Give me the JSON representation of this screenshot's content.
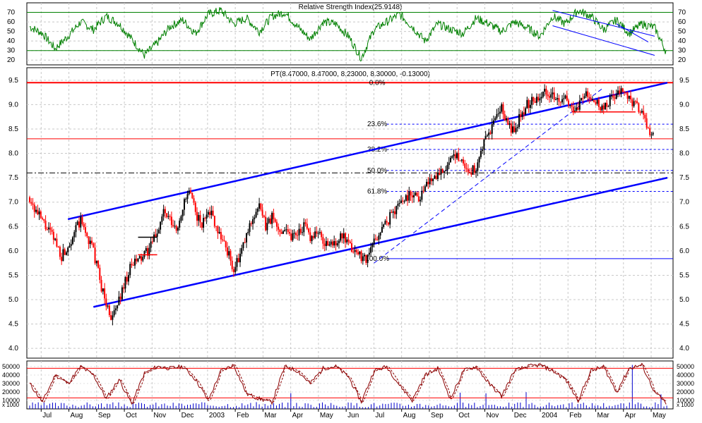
{
  "chart_data": [
    {
      "type": "line",
      "panel": "rsi",
      "title": "Relative Strength Index(25.9148)",
      "ylim": [
        15,
        80
      ],
      "yticks": [
        20,
        30,
        40,
        50,
        60,
        70
      ],
      "reference_lines": [
        30,
        70
      ],
      "grid": true,
      "colors": {
        "line": "#008000",
        "reference": "#008000",
        "trend": "#0000ff"
      },
      "series": [
        {
          "x": [
            0,
            2,
            4,
            6,
            8,
            10,
            12,
            14,
            16,
            18,
            20,
            22,
            24,
            26,
            28,
            30,
            32,
            34,
            36,
            38,
            40,
            42,
            44,
            46,
            48,
            50,
            52,
            54,
            56,
            58,
            60,
            62,
            64,
            66,
            68,
            70,
            72,
            74,
            76,
            78,
            80,
            82,
            84,
            86,
            88,
            90,
            92,
            94,
            96,
            98,
            100
          ],
          "values": [
            55,
            48,
            32,
            45,
            60,
            52,
            66,
            58,
            42,
            25,
            38,
            55,
            62,
            48,
            68,
            72,
            58,
            64,
            50,
            66,
            70,
            55,
            42,
            60,
            58,
            45,
            22,
            52,
            60,
            68,
            55,
            40,
            58,
            52,
            48,
            64,
            58,
            50,
            60,
            54,
            45,
            66,
            58,
            72,
            66,
            52,
            62,
            48,
            58,
            54,
            26
          ]
        }
      ],
      "trend_lines": [
        {
          "points": [
            [
              82,
              72
            ],
            [
              98,
              45
            ]
          ]
        },
        {
          "points": [
            [
              82,
              56
            ],
            [
              98,
              25
            ]
          ]
        },
        {
          "points": [
            [
              92,
              58
            ],
            [
              97,
              39
            ]
          ]
        }
      ]
    },
    {
      "type": "candlestick",
      "panel": "price",
      "title": "PT(8.47000, 8.47000, 8.23000, 8.30000, -0.13000)",
      "ylim": [
        3.8,
        9.7
      ],
      "yticks": [
        4.0,
        4.5,
        5.0,
        5.5,
        6.0,
        6.5,
        7.0,
        7.5,
        8.0,
        8.5,
        9.0,
        9.5
      ],
      "x_tick_labels": [
        "Jul",
        "Aug",
        "Sep",
        "Oct",
        "Nov",
        "Dec",
        "2003",
        "Feb",
        "Mar",
        "Apr",
        "May",
        "Jun",
        "Jul",
        "Aug",
        "Sep",
        "Oct",
        "Nov",
        "Dec",
        "2004",
        "Feb",
        "Mar",
        "Apr",
        "May"
      ],
      "grid": true,
      "colors": {
        "up": "#000000",
        "down": "#ff0000",
        "channel": "#0000ff",
        "level": "#ff0000",
        "fib": "#0000ff"
      },
      "close_path": [
        [
          0,
          7.1
        ],
        [
          1,
          6.8
        ],
        [
          2,
          6.6
        ],
        [
          3,
          6.4
        ],
        [
          4,
          6.2
        ],
        [
          5,
          5.9
        ],
        [
          6,
          6.1
        ],
        [
          7,
          6.4
        ],
        [
          8,
          6.6
        ],
        [
          9,
          6.3
        ],
        [
          10,
          6.0
        ],
        [
          11,
          5.4
        ],
        [
          12,
          4.9
        ],
        [
          13,
          4.6
        ],
        [
          14,
          5.0
        ],
        [
          15,
          5.4
        ],
        [
          16,
          5.7
        ],
        [
          17,
          5.8
        ],
        [
          18,
          5.9
        ],
        [
          19,
          6.1
        ],
        [
          20,
          6.4
        ],
        [
          21,
          6.8
        ],
        [
          22,
          6.6
        ],
        [
          23,
          6.4
        ],
        [
          24,
          6.9
        ],
        [
          25,
          7.2
        ],
        [
          26,
          6.8
        ],
        [
          27,
          6.5
        ],
        [
          28,
          6.9
        ],
        [
          29,
          6.6
        ],
        [
          30,
          6.3
        ],
        [
          31,
          6.0
        ],
        [
          32,
          5.6
        ],
        [
          33,
          5.9
        ],
        [
          34,
          6.3
        ],
        [
          35,
          6.7
        ],
        [
          36,
          6.9
        ],
        [
          37,
          6.5
        ],
        [
          38,
          6.7
        ],
        [
          39,
          6.4
        ],
        [
          40,
          6.5
        ],
        [
          41,
          6.3
        ],
        [
          42,
          6.4
        ],
        [
          43,
          6.5
        ],
        [
          44,
          6.3
        ],
        [
          45,
          6.4
        ],
        [
          46,
          6.2
        ],
        [
          47,
          6.1
        ],
        [
          48,
          6.2
        ],
        [
          49,
          6.3
        ],
        [
          50,
          6.1
        ],
        [
          51,
          6.0
        ],
        [
          52,
          5.9
        ],
        [
          53,
          5.85
        ],
        [
          54,
          6.2
        ],
        [
          55,
          6.4
        ],
        [
          56,
          6.6
        ],
        [
          57,
          6.8
        ],
        [
          58,
          7.0
        ],
        [
          59,
          7.1
        ],
        [
          60,
          7.2
        ],
        [
          61,
          7.1
        ],
        [
          62,
          7.3
        ],
        [
          63,
          7.5
        ],
        [
          64,
          7.6
        ],
        [
          65,
          7.7
        ],
        [
          66,
          7.8
        ],
        [
          67,
          8.0
        ],
        [
          68,
          7.8
        ],
        [
          69,
          7.6
        ],
        [
          70,
          7.7
        ],
        [
          71,
          8.1
        ],
        [
          72,
          8.4
        ],
        [
          73,
          8.7
        ],
        [
          74,
          8.9
        ],
        [
          75,
          8.6
        ],
        [
          76,
          8.4
        ],
        [
          77,
          8.8
        ],
        [
          78,
          9.0
        ],
        [
          79,
          9.1
        ],
        [
          80,
          9.2
        ],
        [
          81,
          9.3
        ],
        [
          82,
          9.2
        ],
        [
          83,
          9.0
        ],
        [
          84,
          9.1
        ],
        [
          85,
          8.9
        ],
        [
          86,
          9.0
        ],
        [
          87,
          9.2
        ],
        [
          88,
          9.1
        ],
        [
          89,
          9.0
        ],
        [
          90,
          8.9
        ],
        [
          91,
          9.1
        ],
        [
          92,
          9.2
        ],
        [
          93,
          9.3
        ],
        [
          94,
          9.1
        ],
        [
          95,
          9.0
        ],
        [
          96,
          8.8
        ],
        [
          97,
          8.5
        ],
        [
          98,
          8.3
        ]
      ],
      "horizontal_levels": [
        {
          "value": 9.45,
          "style": "solid",
          "color": "#ff0000"
        },
        {
          "value": 8.3,
          "style": "solid",
          "color": "#ff0000"
        },
        {
          "value": 7.6,
          "style": "dashdot",
          "color": "#000000"
        }
      ],
      "fibonacci": [
        {
          "label": "0.0%",
          "value": 9.45
        },
        {
          "label": "23.6%",
          "value": 8.6
        },
        {
          "label": "38.2%",
          "value": 8.08
        },
        {
          "label": "50.0%",
          "value": 7.65
        },
        {
          "label": "61.8%",
          "value": 7.22
        },
        {
          "label": "100.0%",
          "value": 5.84
        }
      ],
      "channel_lines": [
        {
          "points": [
            [
              6,
              6.65
            ],
            [
              100,
              9.45
            ]
          ]
        },
        {
          "points": [
            [
              10,
              4.85
            ],
            [
              100,
              7.5
            ]
          ]
        },
        {
          "points": [
            [
              54,
              5.75
            ],
            [
              90,
              9.35
            ]
          ],
          "style": "dashed"
        }
      ],
      "short_levels": [
        {
          "from": 17,
          "to": 20,
          "value": 6.28,
          "color": "#000000"
        },
        {
          "from": 17,
          "to": 20,
          "value": 5.92,
          "color": "#ff0000"
        },
        {
          "from": 85,
          "to": 95,
          "value": 8.85,
          "color": "#ff0000"
        }
      ]
    },
    {
      "type": "line",
      "panel": "volume",
      "units": "x 1000",
      "ylim": [
        0,
        55000
      ],
      "yticks": [
        10000,
        20000,
        30000,
        40000,
        50000
      ],
      "reference_lines": [
        13000,
        48000
      ],
      "colors": {
        "stoch": "#8b0000",
        "signal": "#8b0000",
        "volume": "#0000cc",
        "reference": "#ff0000"
      },
      "series": [
        {
          "x": [
            0,
            2,
            4,
            6,
            8,
            10,
            12,
            14,
            16,
            18,
            20,
            22,
            24,
            26,
            28,
            30,
            32,
            34,
            36,
            38,
            40,
            42,
            44,
            46,
            48,
            50,
            52,
            54,
            56,
            58,
            60,
            62,
            64,
            66,
            68,
            70,
            72,
            74,
            76,
            78,
            80,
            82,
            84,
            86,
            88,
            90,
            92,
            94,
            96,
            98,
            100
          ],
          "values": [
            30000,
            8000,
            40000,
            30000,
            50000,
            40000,
            12000,
            35000,
            6000,
            42000,
            50000,
            48000,
            50000,
            35000,
            10000,
            45000,
            52000,
            18000,
            12000,
            8000,
            50000,
            45000,
            30000,
            48000,
            50000,
            38000,
            8000,
            45000,
            50000,
            28000,
            10000,
            40000,
            48000,
            12000,
            45000,
            50000,
            30000,
            15000,
            45000,
            50000,
            52000,
            45000,
            35000,
            10000,
            45000,
            50000,
            20000,
            48000,
            52000,
            20000,
            5000
          ]
        }
      ]
    }
  ]
}
